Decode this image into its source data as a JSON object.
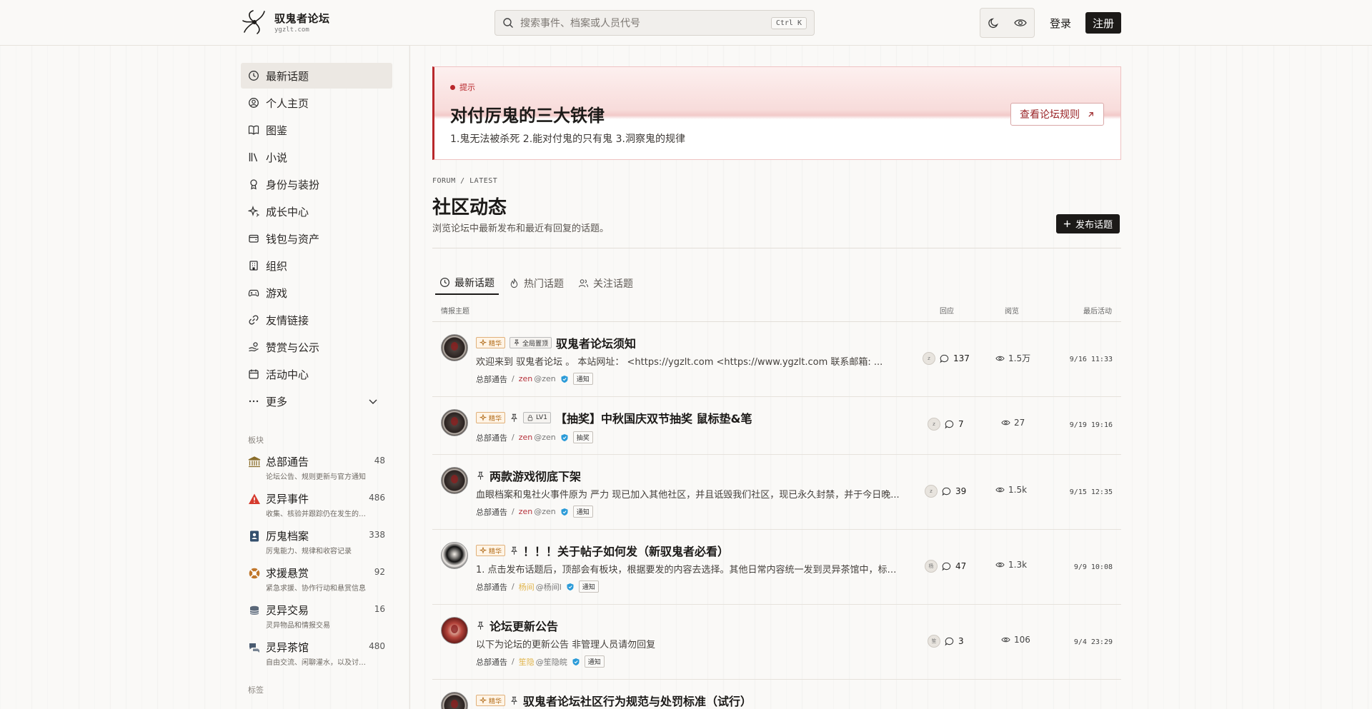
{
  "header": {
    "site_title": "驭鬼者论坛",
    "site_domain": "ygzlt.com",
    "search_placeholder": "搜索事件、档案或人员代号",
    "search_shortcut": "Ctrl K",
    "login_label": "登录",
    "register_label": "注册"
  },
  "sidebar": {
    "nav": [
      {
        "label": "最新话题",
        "icon": "clock-icon",
        "active": true
      },
      {
        "label": "个人主页",
        "icon": "user-circle-icon"
      },
      {
        "label": "图鉴",
        "icon": "book-icon"
      },
      {
        "label": "小说",
        "icon": "library-icon"
      },
      {
        "label": "身份与装扮",
        "icon": "award-icon"
      },
      {
        "label": "成长中心",
        "icon": "sparkles-icon"
      },
      {
        "label": "钱包与资产",
        "icon": "wallet-icon"
      },
      {
        "label": "组织",
        "icon": "building-icon"
      },
      {
        "label": "游戏",
        "icon": "gamepad-icon"
      },
      {
        "label": "友情链接",
        "icon": "link-icon"
      },
      {
        "label": "赞赏与公示",
        "icon": "hand-coins-icon"
      },
      {
        "label": "活动中心",
        "icon": "calendar-icon"
      },
      {
        "label": "更多",
        "icon": "more-icon"
      }
    ],
    "boards_label": "板块",
    "boards": [
      {
        "name": "总部通告",
        "desc": "论坛公告、规则更新与官方通知",
        "count": "48",
        "icon": "bank-icon",
        "color": "#8a6d2a"
      },
      {
        "name": "灵异事件",
        "desc": "收集、核验并跟踪仍在发生的灵异...",
        "count": "486",
        "icon": "warning-icon",
        "color": "#d63b2e"
      },
      {
        "name": "厉鬼档案",
        "desc": "厉鬼能力、规律和收容记录",
        "count": "338",
        "icon": "dossier-icon",
        "color": "#34506e"
      },
      {
        "name": "求援悬赏",
        "desc": "紧急求援、协作行动和悬赏信息",
        "count": "92",
        "icon": "lifebuoy-icon",
        "color": "#c0762a"
      },
      {
        "name": "灵异交易",
        "desc": "灵异物品和情报交易",
        "count": "16",
        "icon": "coins-icon",
        "color": "#5a6778"
      },
      {
        "name": "灵异茶馆",
        "desc": "自由交流、闲聊灌水，以及讨论与...",
        "count": "480",
        "icon": "chat-icon",
        "color": "#4a5b70"
      }
    ],
    "tags_label": "标签"
  },
  "notice": {
    "tag": "提示",
    "title": "对付厉鬼的三大铁律",
    "desc": "1.鬼无法被杀死 2.能对付鬼的只有鬼 3.洞察鬼的规律",
    "button": "查看论坛规则"
  },
  "page": {
    "crumb": "FORUM / LATEST",
    "title": "社区动态",
    "subtitle": "浏览论坛中最新发布和最近有回复的话题。",
    "post_button": "发布话题"
  },
  "tabs": [
    {
      "label": "最新话题",
      "icon": "clock-icon",
      "active": true
    },
    {
      "label": "热门话题",
      "icon": "flame-icon"
    },
    {
      "label": "关注话题",
      "icon": "users-icon"
    }
  ],
  "table_header": {
    "topic": "情报主题",
    "replies": "回应",
    "views": "阅览",
    "activity": "最后活动"
  },
  "topics": [
    {
      "badges": [
        {
          "t": "精华",
          "c": "gold"
        },
        {
          "t": "全局置顶",
          "c": "gray"
        }
      ],
      "pin": false,
      "lock": null,
      "title": "驭鬼者论坛须知",
      "excerpt": "欢迎来到 驭鬼者论坛 。 本站网址： <https://ygzlt.com <https://www.ygzlt.com 联系邮箱: ...",
      "board": "总部通告",
      "author": "zen",
      "handle": "@zen",
      "author_style": "red",
      "tag": "通知",
      "mini": "z",
      "replies": "137",
      "views": "1.5万",
      "time": "9/16 11:33",
      "avatar": "v1"
    },
    {
      "badges": [
        {
          "t": "精华",
          "c": "gold"
        }
      ],
      "pin": true,
      "lock": "LV1",
      "title": "【抽奖】中秋国庆双节抽奖 鼠标垫&笔",
      "excerpt": "",
      "board": "总部通告",
      "author": "zen",
      "handle": "@zen",
      "author_style": "red",
      "tag": "抽奖",
      "mini": "z",
      "replies": "7",
      "views": "27",
      "time": "9/19 19:16",
      "avatar": "v1"
    },
    {
      "badges": [],
      "pin": true,
      "lock": null,
      "title": "两款游戏彻底下架",
      "excerpt": "血眼档案和鬼社火事件原为 严力 现已加入其他社区，并且诋毁我们社区，现已永久封禁，并于今日晚...",
      "board": "总部通告",
      "author": "zen",
      "handle": "@zen",
      "author_style": "red",
      "tag": "通知",
      "mini": "z",
      "replies": "39",
      "views": "1.5k",
      "time": "9/15 12:35",
      "avatar": "v1"
    },
    {
      "badges": [
        {
          "t": "精华",
          "c": "gold"
        }
      ],
      "pin": true,
      "lock": null,
      "title": "！！！关于帖子如何发（新驭鬼者必看）",
      "excerpt": "1. 点击发布话题后，顶部会有板块，根据要发的内容去选择。其他日常内容统一发到灵异茶馆中，标签...",
      "board": "总部通告",
      "author": "杨间",
      "handle": "@杨间l",
      "author_style": "yellow",
      "tag": "通知",
      "mini": "杨",
      "replies": "47",
      "views": "1.3k",
      "time": "9/9 10:08",
      "avatar": "v2"
    },
    {
      "badges": [],
      "pin": true,
      "lock": null,
      "title": "论坛更新公告",
      "excerpt": "以下为论坛的更新公告 非管理人员请勿回复",
      "board": "总部通告",
      "author": "笙隐",
      "handle": "@笙隐皖",
      "author_style": "yellow",
      "tag": "通知",
      "mini": "笙",
      "replies": "3",
      "views": "106",
      "time": "9/4 23:29",
      "avatar": "v3"
    },
    {
      "badges": [
        {
          "t": "精华",
          "c": "gold"
        }
      ],
      "pin": true,
      "lock": null,
      "title": "驭鬼者论坛社区行为规范与处罚标准（试行）",
      "excerpt": "",
      "board": "",
      "author": "",
      "handle": "",
      "author_style": "red",
      "tag": "",
      "mini": "",
      "replies": "",
      "views": "",
      "time": "",
      "avatar": "v1"
    }
  ]
}
